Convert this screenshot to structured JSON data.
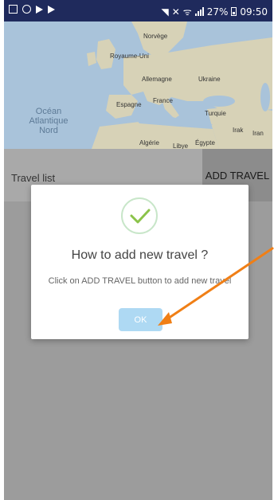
{
  "status_bar": {
    "time": "09:50",
    "battery_percent": "27%",
    "icons": [
      "gallery-icon",
      "key-icon",
      "play-icon",
      "play-icon",
      "nfc-icon",
      "mute-icon",
      "wifi-icon",
      "signal-icon",
      "battery-icon"
    ]
  },
  "map": {
    "labels": {
      "norvege": "Norvège",
      "royaume_uni": "Royaume-Uni",
      "allemagne": "Allemagne",
      "ukraine": "Ukraine",
      "france": "France",
      "espagne": "Espagne",
      "turquie": "Turquie",
      "ocean_line1": "Océan",
      "ocean_line2": "Atlantique",
      "ocean_line3": "Nord",
      "irak": "Irak",
      "iran": "Iran",
      "algerie": "Algérie",
      "libye": "Libye",
      "egypte": "Égypte"
    },
    "colors": {
      "water": "#a9c3da",
      "land": "#d7d2b7"
    }
  },
  "toolbar": {
    "travel_list_label": "Travel list",
    "add_travel_label": "ADD TRAVEL"
  },
  "dialog": {
    "title": "How to add new travel ?",
    "message": "Click on ADD TRAVEL button to add new travel",
    "ok_label": "OK",
    "icon": "check-icon",
    "check_color": "#8bc34a",
    "ok_color": "#aed9f3"
  },
  "annotation": {
    "arrow_color": "#f07f16"
  }
}
